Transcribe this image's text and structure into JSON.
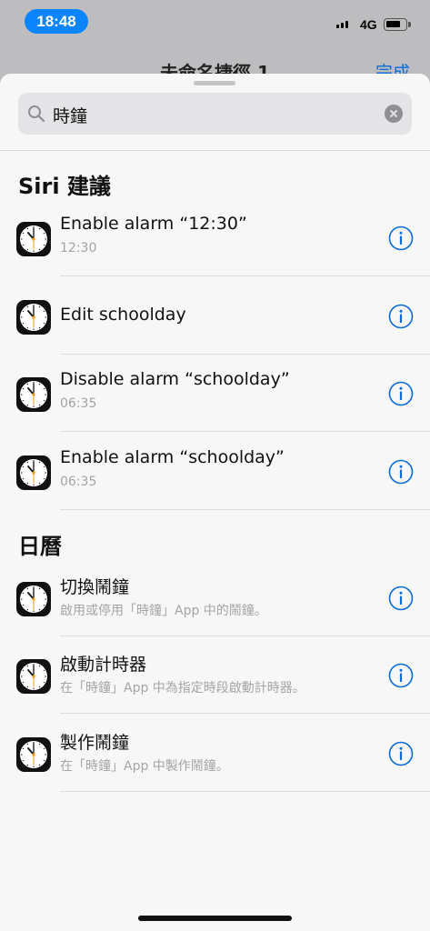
{
  "status": {
    "time": "18:48",
    "network": "4G"
  },
  "background": {
    "title": "未命名捷徑 1",
    "done": "完成"
  },
  "search": {
    "value": "時鐘"
  },
  "sections": [
    {
      "title": "Siri 建議"
    },
    {
      "title": "日曆"
    }
  ],
  "rows": [
    {
      "title": "Enable alarm “12:30”",
      "subtitle": "12:30"
    },
    {
      "title": "Edit schoolday",
      "subtitle": ""
    },
    {
      "title": "Disable alarm “schoolday”",
      "subtitle": "06:35"
    },
    {
      "title": "Enable alarm “schoolday”",
      "subtitle": "06:35"
    },
    {
      "title": "切換鬧鐘",
      "subtitle": "啟用或停用「時鐘」App 中的鬧鐘。"
    },
    {
      "title": "啟動計時器",
      "subtitle": "在「時鐘」App 中為指定時段啟動計時器。"
    },
    {
      "title": "製作鬧鐘",
      "subtitle": "在「時鐘」App 中製作鬧鐘。"
    }
  ],
  "icons": {
    "row": "clock-app-icon",
    "info": "info-icon",
    "search": "search-icon",
    "clear": "clear-icon"
  },
  "colors": {
    "accent": "#0a6cd9",
    "time_pill": "#0a84ff"
  }
}
